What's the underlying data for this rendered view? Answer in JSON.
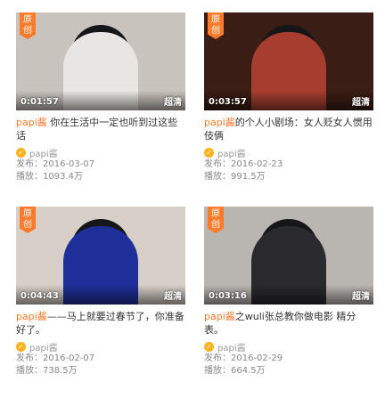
{
  "cards": [
    {
      "badge": "原创",
      "duration": "0:01:57",
      "quality": "超清",
      "author": "papi酱",
      "title_rest": " 你在生活中一定也听到过这些话",
      "channel": "papi酱",
      "publish_label": "发布：",
      "publish_date": "2016-03-07",
      "plays_label": "播放：",
      "plays": "1093.4万",
      "colors": {
        "bg": "#c9c3bd",
        "shirt": "#e8e6e4"
      }
    },
    {
      "badge": "原创",
      "duration": "0:03:57",
      "quality": "超清",
      "author": "papi酱",
      "title_rest": "的个人小剧场：女人贬女人惯用伎俩",
      "channel": "papi酱",
      "publish_label": "发布：",
      "publish_date": "2016-02-23",
      "plays_label": "播放：",
      "plays": "991.5万",
      "colors": {
        "bg": "#3a1d14",
        "shirt": "#a63d2e"
      }
    },
    {
      "badge": "原创",
      "duration": "0:04:43",
      "quality": "超清",
      "author": "papi酱",
      "title_rest": "——马上就要过春节了，你准备好了。",
      "channel": "papi酱",
      "publish_label": "发布：",
      "publish_date": "2016-02-07",
      "plays_label": "播放：",
      "plays": "738.5万",
      "colors": {
        "bg": "#d8d0c8",
        "shirt": "#1f2f9a"
      }
    },
    {
      "badge": "原创",
      "duration": "0:03:16",
      "quality": "超清",
      "author": "papi酱",
      "title_rest": "之wuli张总教你做电影 精分表。",
      "channel": "papi酱",
      "publish_label": "发布：",
      "publish_date": "2016-02-29",
      "plays_label": "播放：",
      "plays": "664.5万",
      "colors": {
        "bg": "#b9b5b0",
        "shirt": "#2a2a2e"
      }
    }
  ]
}
